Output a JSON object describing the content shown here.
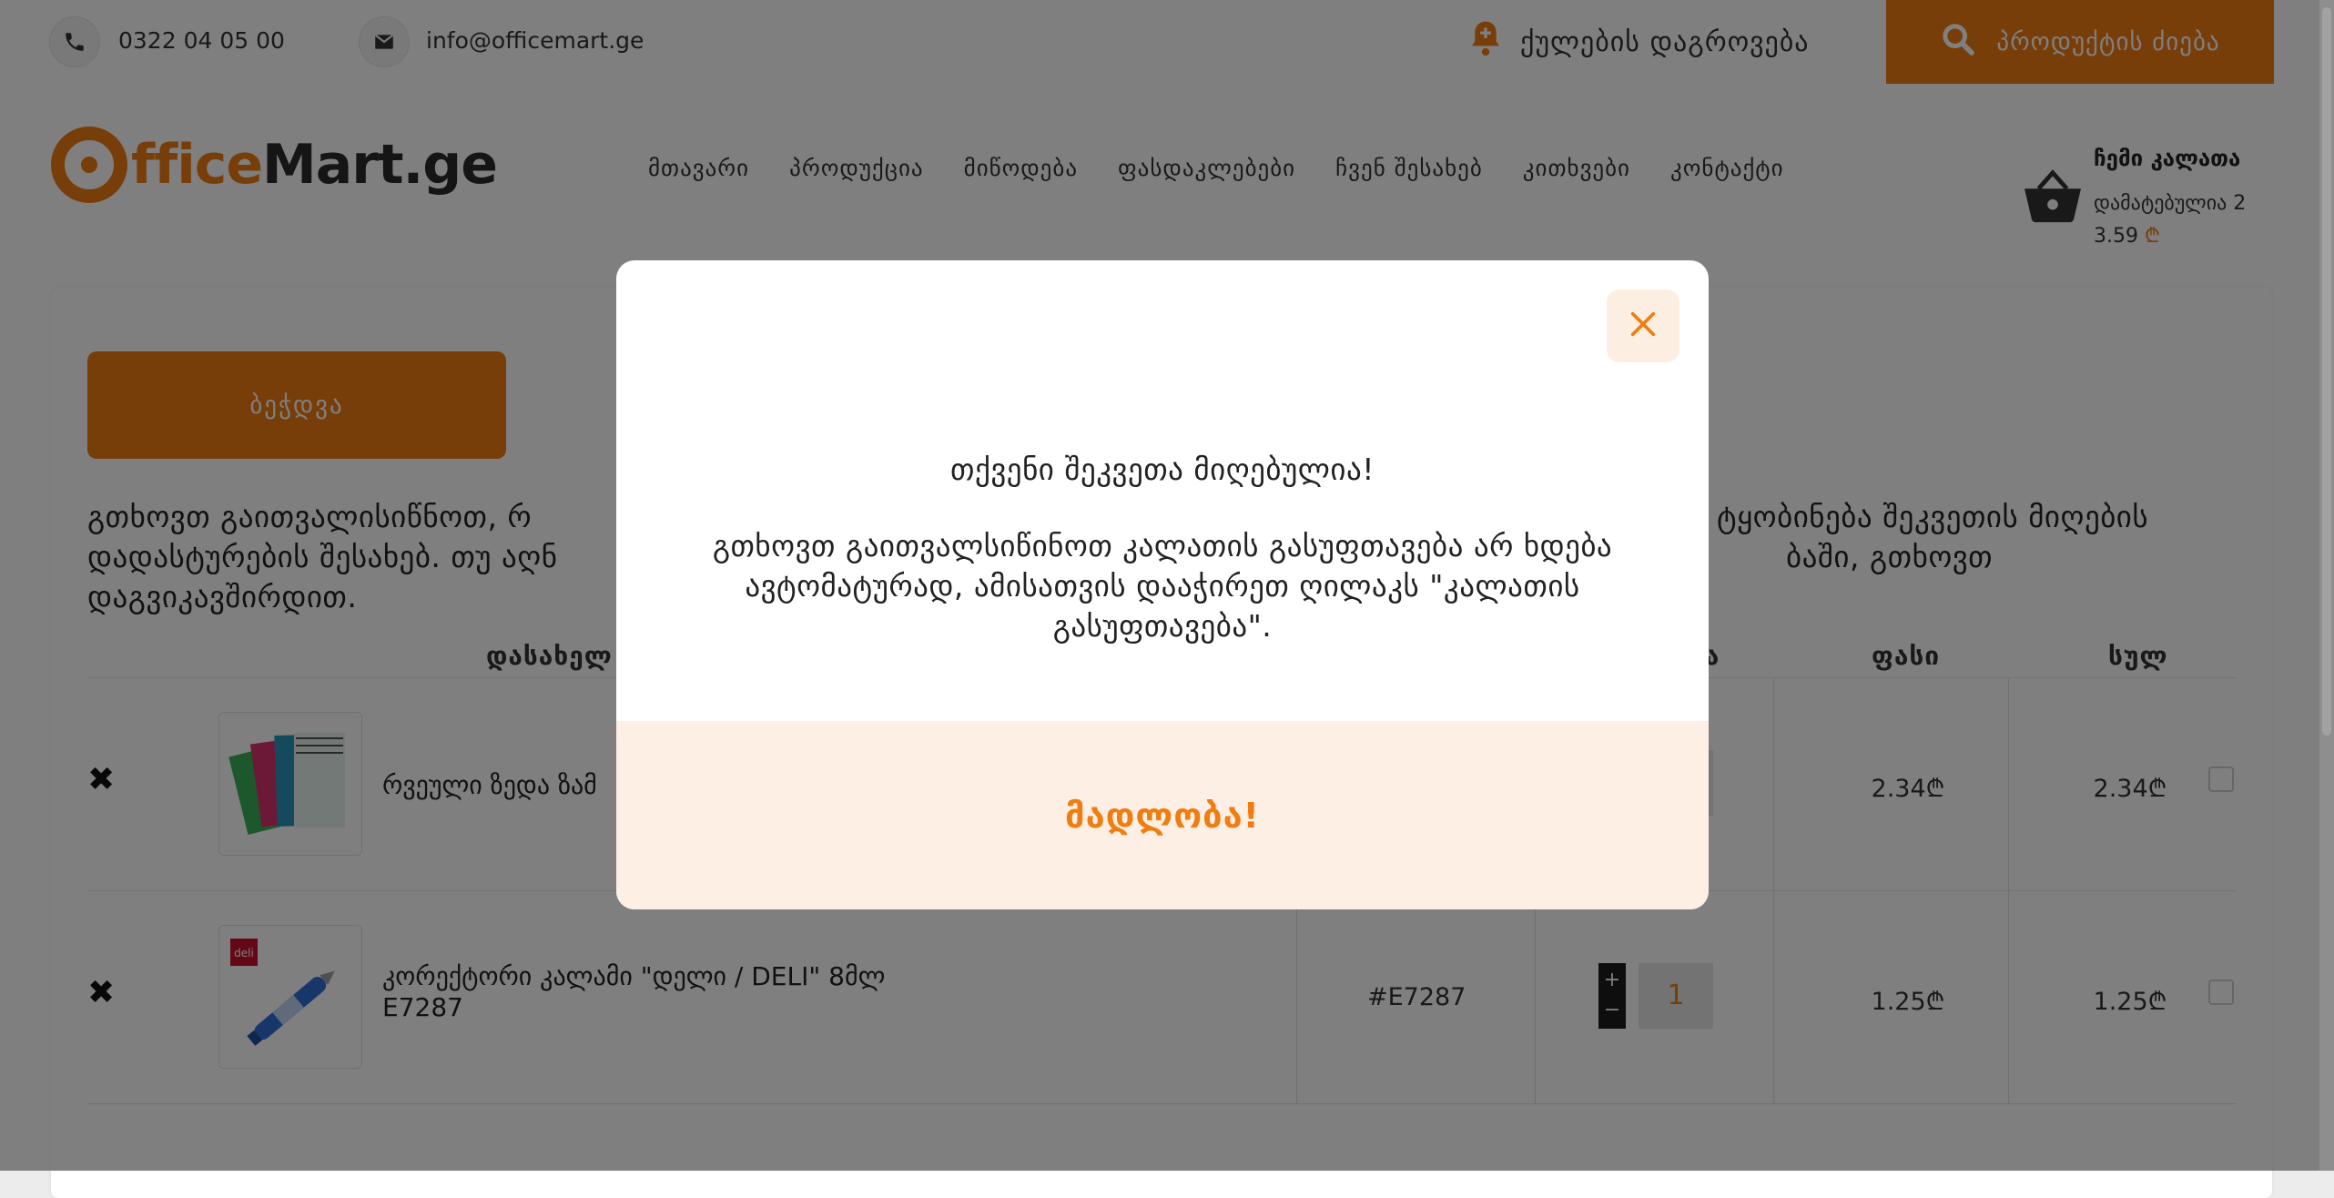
{
  "topbar": {
    "phone": "0322 04 05 00",
    "email": "info@officemart.ge",
    "bonus_label": "ქულების დაგროვება",
    "search_label": "პროდუქტის ძიება"
  },
  "logo": {
    "part1": "ffice",
    "part2": "Mart.ge"
  },
  "nav": {
    "items": [
      "მთავარი",
      "პროდუქცია",
      "მიწოდება",
      "ფასდაკლებები",
      "ჩვენ შესახებ",
      "კითხვები",
      "კონტაქტი"
    ]
  },
  "cart": {
    "title": "ჩემი კალათა",
    "added_text": "დამატებულია 2",
    "amount": "3.59",
    "currency": "₾"
  },
  "main": {
    "print_label": "ბეჭდვა",
    "notice": "გთხოვთ გაითვალისიწნოთ, რ                                                                                                                                                              ტყობინება შეკვეთის მიღების დადასტურების შესახებ. თუ აღნ                                                                                                                                                    ბაში, გთხოვთ დაგვიკავშირდით.",
    "notice_line1_left": "გთხოვთ გაითვალისიწნოთ, რ",
    "notice_line1_right": "ტყობინება შეკვეთის მიღების",
    "notice_line2_left": "დადასტურების შესახებ. თუ აღნ",
    "notice_line2_right": "ბაში, გთხოვთ",
    "notice_line3": "დაგვიკავშირდით.",
    "columns": {
      "name": "დასახელ",
      "qty": "ბა",
      "price": "ფასი",
      "total": "სულ"
    },
    "rows": [
      {
        "remove": "✖",
        "name": "რვეული ზედა ზამ",
        "code": "",
        "qty": "",
        "price": "2.34₾",
        "total": "2.34₾"
      },
      {
        "remove": "✖",
        "name_line1": "კორექტორი კალამი \"დელი / DELI\" 8მლ",
        "name_line2": "E7287",
        "code": "#E7287",
        "qty": "1",
        "price": "1.25₾",
        "total": "1.25₾"
      }
    ]
  },
  "modal": {
    "title": "თქვენი შეკვეთა მიღებულია!",
    "body": "გთხოვთ გაითვალსიწინოთ კალათის გასუფთავება არ ხდება ავტომატურად, ამისათვის დააჭირეთ ღილაკს \"კალათის გასუფთავება\".",
    "thanks": "მადლობა!"
  },
  "colors": {
    "accent": "#f07d12",
    "overlay": "rgba(0,0,0,0.5)"
  },
  "icons": [
    "phone-icon",
    "mail-icon",
    "bell-icon",
    "search-icon",
    "cart-basket-icon",
    "close-icon"
  ]
}
